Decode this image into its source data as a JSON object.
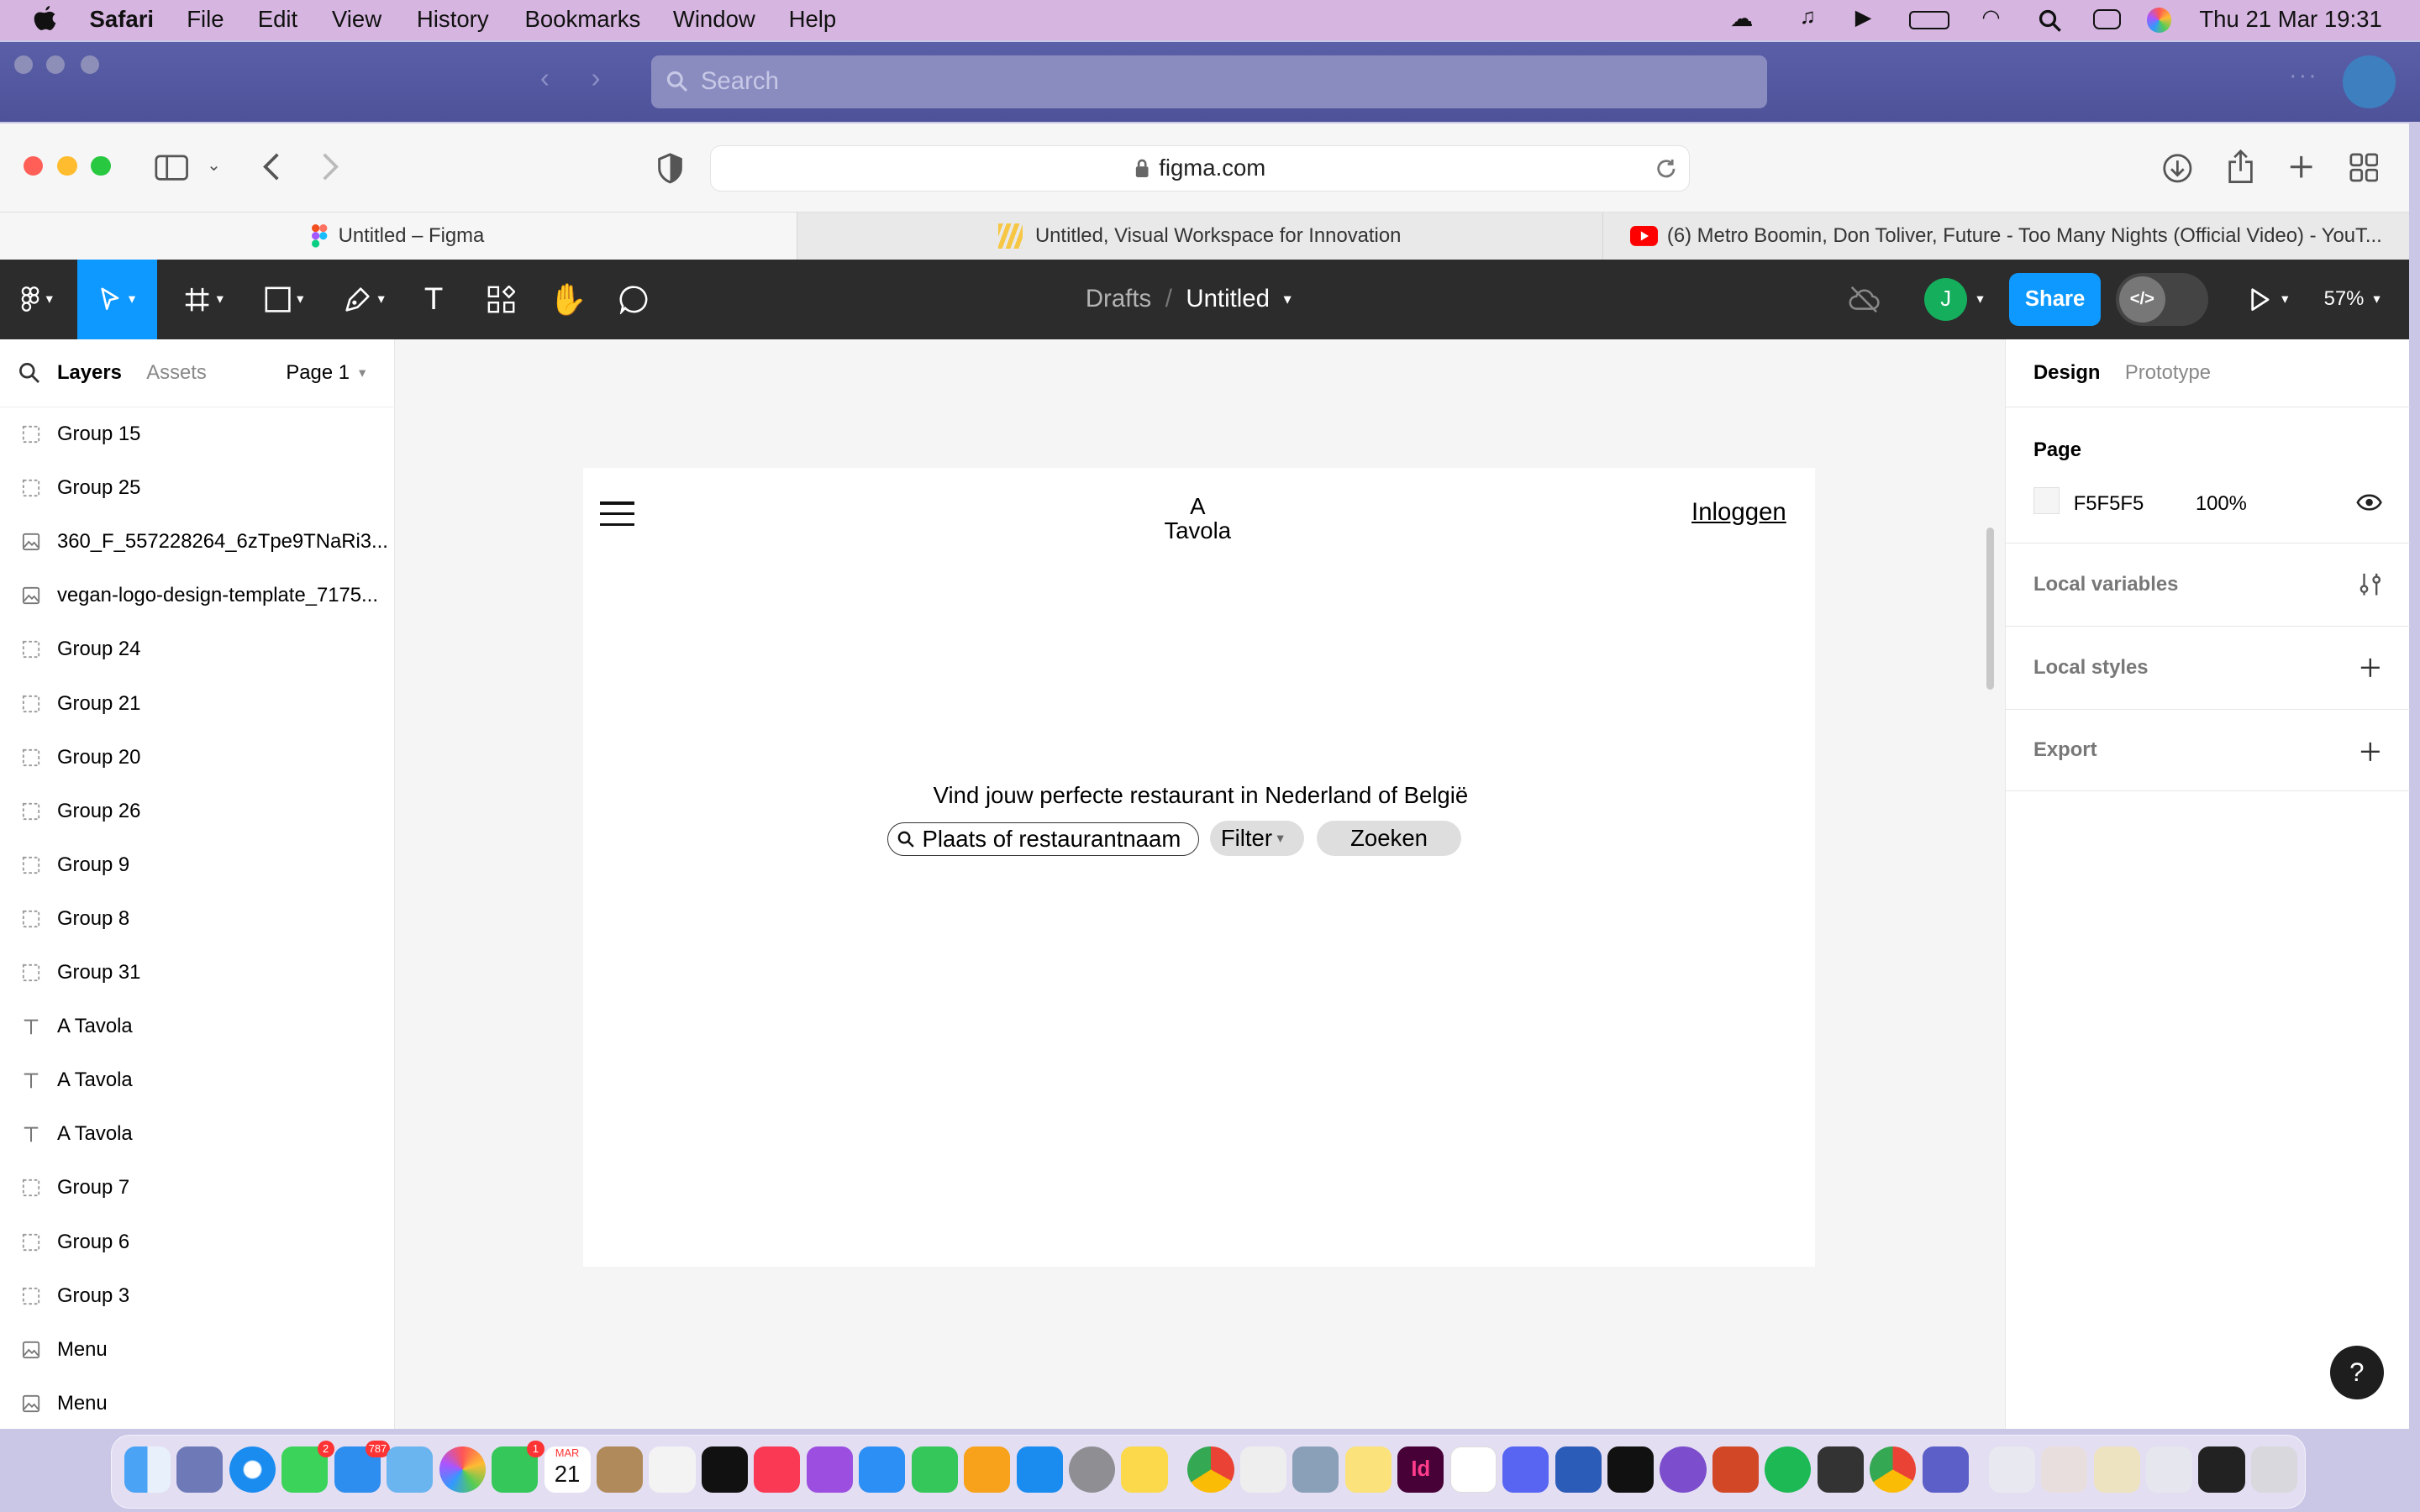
{
  "menubar": {
    "app": "Safari",
    "items": [
      "File",
      "Edit",
      "View",
      "History",
      "Bookmarks",
      "Window",
      "Help"
    ],
    "clock": "Thu 21 Mar  19:31"
  },
  "remote": {
    "search_placeholder": "Search"
  },
  "browser": {
    "url": "figma.com",
    "tabs": [
      "Untitled – Figma",
      "Untitled, Visual Workspace for Innovation",
      "(6) Metro Boomin, Don Toliver, Future - Too Many Nights (Official Video) - YouT..."
    ]
  },
  "figma": {
    "breadcrumb_parent": "Drafts",
    "breadcrumb_sep": "/",
    "file_name": "Untitled",
    "avatar_initial": "J",
    "share": "Share",
    "zoom": "57%",
    "left": {
      "tab_layers": "Layers",
      "tab_assets": "Assets",
      "page": "Page 1",
      "layers": [
        {
          "type": "group",
          "name": "Group 15"
        },
        {
          "type": "group",
          "name": "Group 25"
        },
        {
          "type": "image",
          "name": "360_F_557228264_6zTpe9TNaRi3..."
        },
        {
          "type": "image",
          "name": "vegan-logo-design-template_7175..."
        },
        {
          "type": "group",
          "name": "Group 24"
        },
        {
          "type": "group",
          "name": "Group 21"
        },
        {
          "type": "group",
          "name": "Group 20"
        },
        {
          "type": "group",
          "name": "Group 26"
        },
        {
          "type": "group",
          "name": "Group 9"
        },
        {
          "type": "group",
          "name": "Group 8"
        },
        {
          "type": "group",
          "name": "Group 31"
        },
        {
          "type": "text",
          "name": "A Tavola"
        },
        {
          "type": "text",
          "name": "A Tavola"
        },
        {
          "type": "text",
          "name": "A Tavola"
        },
        {
          "type": "group",
          "name": "Group 7"
        },
        {
          "type": "group",
          "name": "Group 6"
        },
        {
          "type": "group",
          "name": "Group 3"
        },
        {
          "type": "image",
          "name": "Menu"
        },
        {
          "type": "image",
          "name": "Menu"
        }
      ]
    },
    "right": {
      "tab_design": "Design",
      "tab_prototype": "Prototype",
      "page_label": "Page",
      "page_color": "F5F5F5",
      "page_opacity": "100%",
      "local_variables": "Local variables",
      "local_styles": "Local styles",
      "export": "Export",
      "help": "?"
    }
  },
  "frame": {
    "logo_line1": "A",
    "logo_line2": "Tavola",
    "login": "Inloggen",
    "headline": "Vind jouw perfecte restaurant in Nederland of België",
    "search_placeholder": "Plaats of restaurantnaam",
    "filter": "Filter",
    "search_button": "Zoeken"
  },
  "dock": {
    "messages_badge": "2",
    "mail_badge": "787",
    "facetime_badge": "1",
    "calendar_month": "MAR",
    "calendar_day": "21"
  }
}
